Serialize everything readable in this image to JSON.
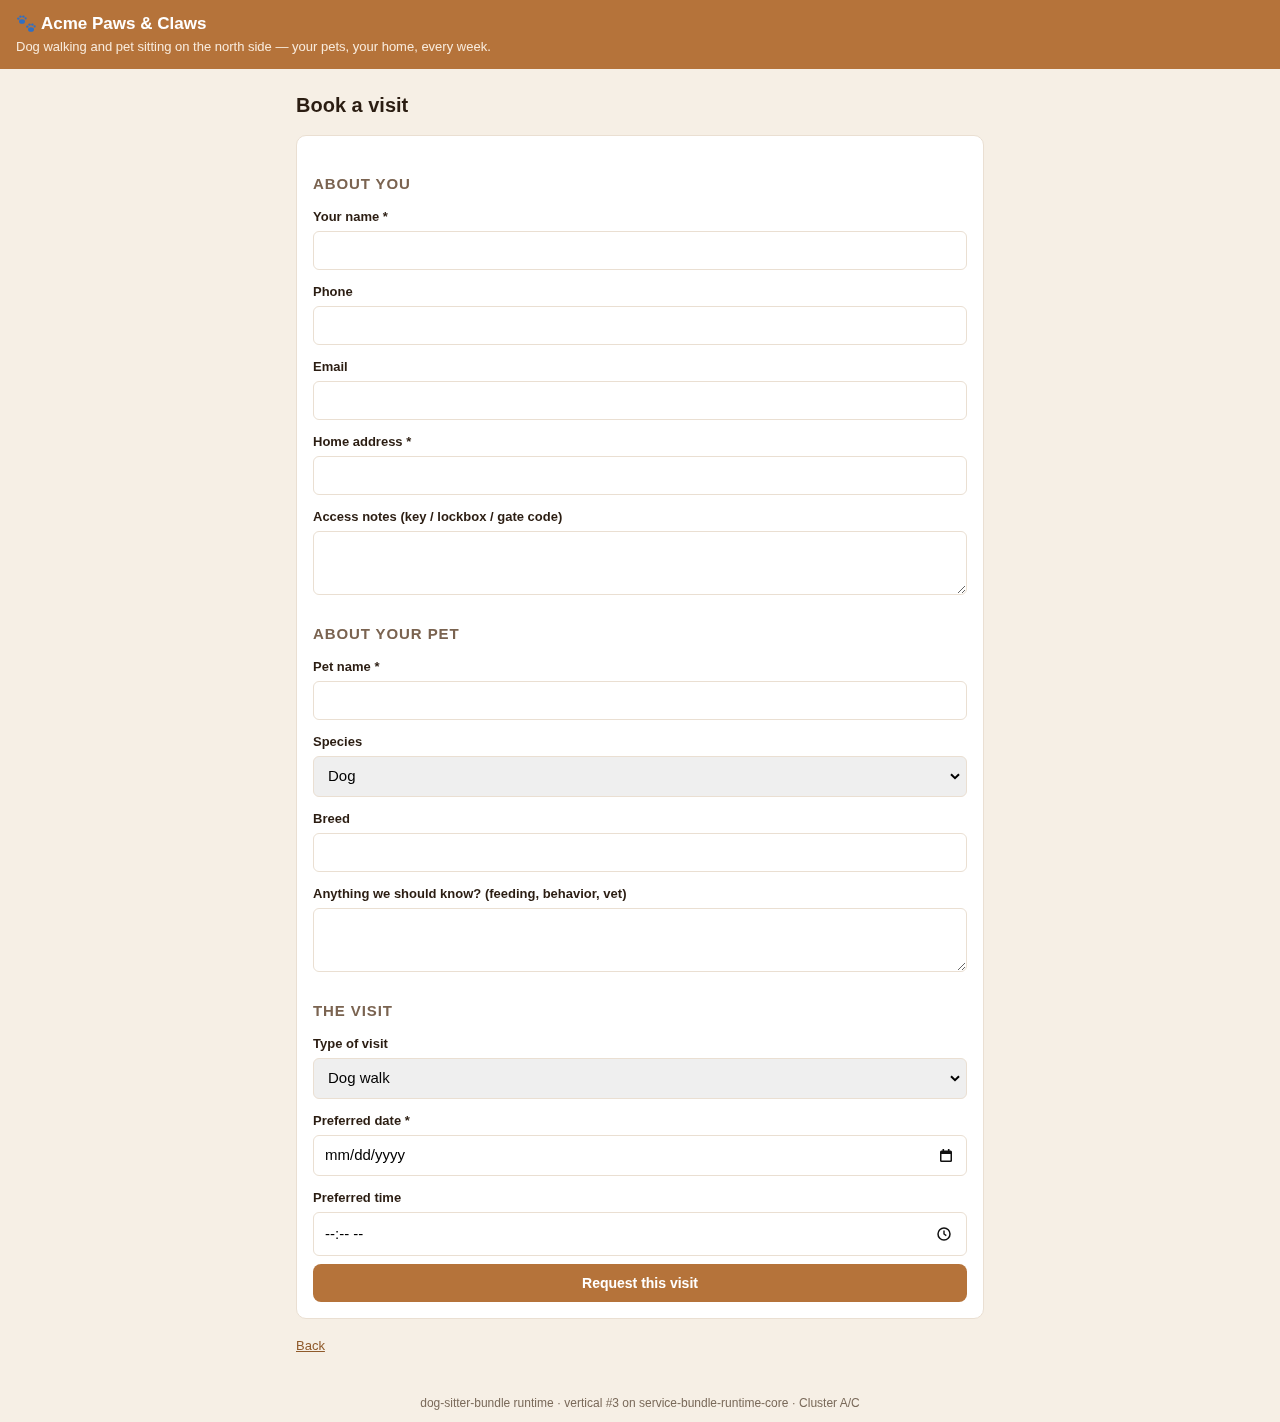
{
  "header": {
    "title": "Acme Paws & Claws",
    "tagline": "Dog walking and pet sitting on the north side — your pets, your home, every week."
  },
  "page_title": "Book a visit",
  "sections": [
    {
      "heading": "ABOUT YOU",
      "fields": [
        {
          "kind": "text",
          "label": "Your name *"
        },
        {
          "kind": "text",
          "label": "Phone"
        },
        {
          "kind": "text",
          "label": "Email"
        },
        {
          "kind": "text",
          "label": "Home address *"
        },
        {
          "kind": "textarea",
          "label": "Access notes (key / lockbox / gate code)"
        }
      ]
    },
    {
      "heading": "ABOUT YOUR PET",
      "fields": [
        {
          "kind": "text",
          "label": "Pet name *"
        },
        {
          "kind": "select",
          "label": "Species",
          "value": "Dog"
        },
        {
          "kind": "text",
          "label": "Breed"
        },
        {
          "kind": "textarea",
          "label": "Anything we should know? (feeding, behavior, vet)"
        }
      ]
    },
    {
      "heading": "THE VISIT",
      "fields": [
        {
          "kind": "select",
          "label": "Type of visit",
          "value": "Dog walk"
        },
        {
          "kind": "date",
          "label": "Preferred date *",
          "placeholder": "mm/dd/yyyy"
        },
        {
          "kind": "time",
          "label": "Preferred time",
          "placeholder": "--:-- --"
        }
      ]
    }
  ],
  "submit_button": "Request this visit",
  "back_link": "Back",
  "footer": "dog-sitter-bundle runtime · vertical #3 on service-bundle-runtime-core · Cluster A/C"
}
